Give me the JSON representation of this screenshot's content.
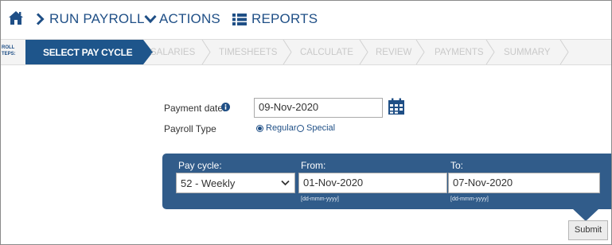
{
  "nav": {
    "run_payroll": "RUN PAYROLL",
    "actions": "ACTIONS",
    "reports": "REPORTS",
    "icons": [
      "home-icon",
      "chevron-right-icon",
      "chevron-down-icon",
      "list-icon"
    ]
  },
  "steps": {
    "label_line1": "ROLL",
    "label_line2": "TEPS:",
    "items": [
      {
        "label": "SELECT PAY CYCLE",
        "active": true
      },
      {
        "label": "SALARIES",
        "active": false
      },
      {
        "label": "TIMESHEETS",
        "active": false
      },
      {
        "label": "CALCULATE",
        "active": false
      },
      {
        "label": "REVIEW",
        "active": false
      },
      {
        "label": "PAYMENTS",
        "active": false
      },
      {
        "label": "SUMMARY",
        "active": false
      }
    ]
  },
  "form": {
    "payment_date_label": "Payment date:",
    "payment_date_value": "09-Nov-2020",
    "payroll_type_label": "Payroll Type",
    "payroll_type_options": [
      "Regular",
      "Special"
    ],
    "payroll_type_selected": "Regular"
  },
  "panel": {
    "pay_cycle_label": "Pay cycle:",
    "pay_cycle_value": "52 - Weekly",
    "from_label": "From:",
    "from_value": "01-Nov-2020",
    "from_format": "[dd-mmm-yyyy]",
    "to_label": "To:",
    "to_value": "07-Nov-2020",
    "to_format": "[dd-mmm-yyyy]"
  },
  "submit_label": "Submit",
  "colors": {
    "brand": "#1f4f86",
    "active_step": "#1e558b",
    "panel": "#315c8a",
    "inactive_step_text": "#c9c9c9"
  }
}
